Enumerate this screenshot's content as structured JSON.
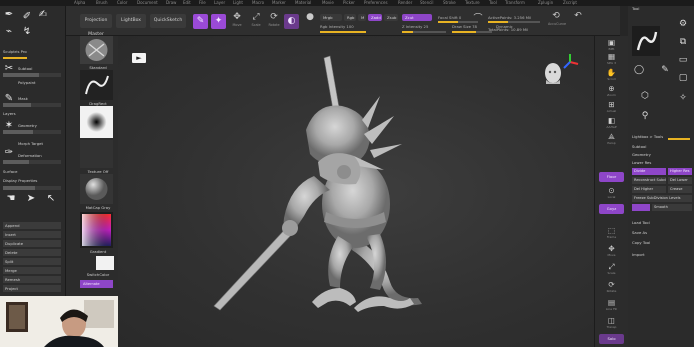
{
  "menubar": [
    "Alpha",
    "Brush",
    "Color",
    "Document",
    "Draw",
    "Edit",
    "File",
    "Layer",
    "Light",
    "Macro",
    "Marker",
    "Material",
    "Movie",
    "Picker",
    "Preferences",
    "Render",
    "Stencil",
    "Stroke",
    "Texture",
    "Tool",
    "Transform",
    "Zplugin",
    "Zscript"
  ],
  "topbar": {
    "projection_master": "Projection Master",
    "lightbox": "LightBox",
    "quicksketch": "QuickSketch",
    "edit": "Edit",
    "draw": "Draw",
    "move": "Move",
    "scale": "Scale",
    "rotate": "Rotate",
    "mrgb": "Mrgb",
    "rgb": "Rgb",
    "m": "M",
    "zadd": "Zadd",
    "zsub": "Zsub",
    "zcut": "Zcut",
    "focal_shift": "Focal Shift 0",
    "draw_size": "Draw Size 78",
    "rgb_intensity": "Rgb Intensity 100",
    "z_intensity": "Z Intensity 25",
    "dynamic": "Dynamic",
    "active_points": "ActivePoints: 3.256 Mil",
    "total_points": "TotalPoints: 10.89 Mil",
    "accucurve": "AccuCurve",
    "colors": {
      "accent": "#9a4ad6",
      "slider": "#e8b323"
    }
  },
  "left_panel": {
    "rows": [
      "Sculptris Pro",
      "Subtool",
      "Polypaint",
      "Mask",
      "Layers",
      "Geometry",
      "Morph Target",
      "Deformation",
      "Surface",
      "Display Properties"
    ],
    "buttons": [
      "Append",
      "Insert",
      "Duplicate",
      "Delete",
      "Split",
      "Merge",
      "Remesh",
      "Project"
    ]
  },
  "shelf": {
    "labels": [
      "Standard",
      "DragRect",
      "Alpha Off",
      "Texture Off",
      "MatCap Gray",
      "Gradient",
      "SwitchColor",
      "Alternate"
    ]
  },
  "canvas": {
    "model_description_icon": "sculpt-model",
    "gizmo_icon": "axis-gizmo-icon"
  },
  "right_toolbar": {
    "items": [
      "BPR",
      "SPix 3",
      "Scroll",
      "Zoom",
      "Actual",
      "AAHalf",
      "Persp",
      "Floor",
      "Local",
      "Gxyz",
      "Frame",
      "Move",
      "Scale",
      "Rotate",
      "Line Fill",
      "Transp",
      "Solo",
      "Xpose"
    ],
    "purple_items": [
      "Floor",
      "Gxyz"
    ]
  },
  "right_panel": {
    "title": "Tool",
    "rows": [
      "Load Tool",
      "Save As",
      "Copy Tool",
      "Paste Tool",
      "Import",
      "Export",
      "Clone",
      "Make PolyMesh3D",
      "GoZ",
      "All",
      "Visible",
      "R",
      "Lightbox > Tools",
      "SimpleBrush",
      "Subtool",
      "Geometry",
      "Lower Res",
      "Higher Res",
      "Divide",
      "Reconstruct Subdiv",
      "Del Lower",
      "Del Higher",
      "Freeze SubDivision Levels",
      "Crease",
      "Smooth"
    ],
    "purple_buttons": [
      "Divide",
      "Higher Res"
    ]
  }
}
